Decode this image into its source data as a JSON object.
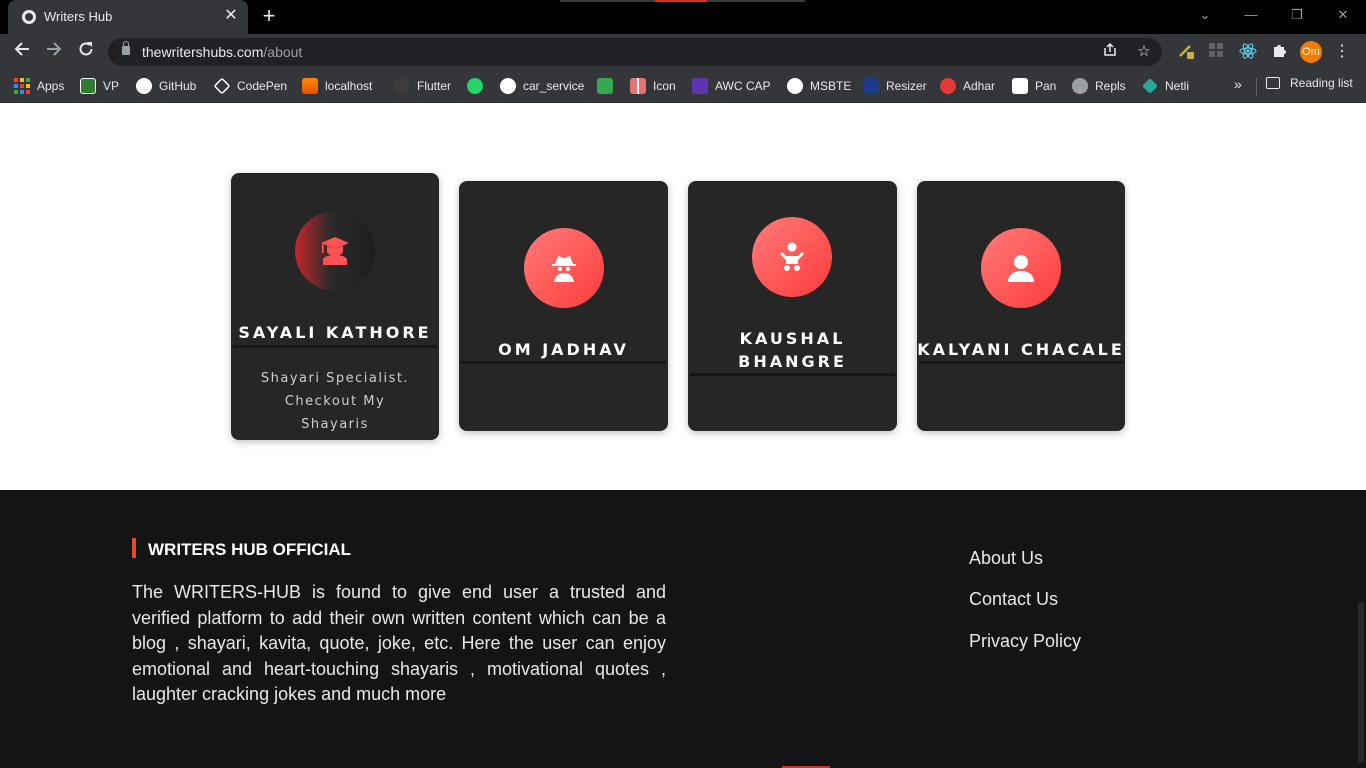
{
  "browser": {
    "tab_title": "Writers Hub",
    "new_tab": "+",
    "close": "✕",
    "window_controls": [
      "⌄",
      "—",
      "❐",
      "✕"
    ],
    "url_host": "thewritershubs.com",
    "url_path": "/about",
    "profile_initials": "Om",
    "bookmarks": [
      "Apps",
      "VP",
      "GitHub",
      "CodePen",
      "localhost",
      "Flutter",
      "",
      "car_service",
      "",
      "Icon",
      "AWC CAP",
      "MSBTE",
      "Resizer",
      "Adhar",
      "Pan",
      "Repls",
      "Netli"
    ],
    "bookmarks_more": "»",
    "reading_list": "Reading list"
  },
  "team": [
    {
      "name_line1": "SAYALI KATHORE",
      "name_line2": "",
      "description": [
        "Shayari Specialist.",
        "Checkout My",
        "Shayaris"
      ],
      "icon": "graduate-icon"
    },
    {
      "name_line1": "OM JADHAV",
      "name_line2": "",
      "description": [],
      "icon": "spy-icon"
    },
    {
      "name_line1": "KAUSHAL",
      "name_line2": "BHANGRE",
      "description": [],
      "icon": "baby-icon"
    },
    {
      "name_line1": "KALYANI CHACALE",
      "name_line2": "",
      "description": [],
      "icon": "user-icon"
    }
  ],
  "footer": {
    "title": "WRITERS HUB OFFICIAL",
    "about_text": "The WRITERS-HUB is found to give end user a trusted and verified platform to add their own written content which can be a blog , shayari, kavita, quote, joke, etc. Here the user can enjoy emotional and heart-touching shayaris , motivational quotes , laughter cracking jokes and much more",
    "links": [
      "About Us",
      "Contact Us",
      "Privacy Policy"
    ]
  },
  "colors": {
    "accent": "#ff4b4b",
    "card_bg": "#262626",
    "footer_bg": "#141414",
    "footer_bar": "#e84c1e"
  }
}
